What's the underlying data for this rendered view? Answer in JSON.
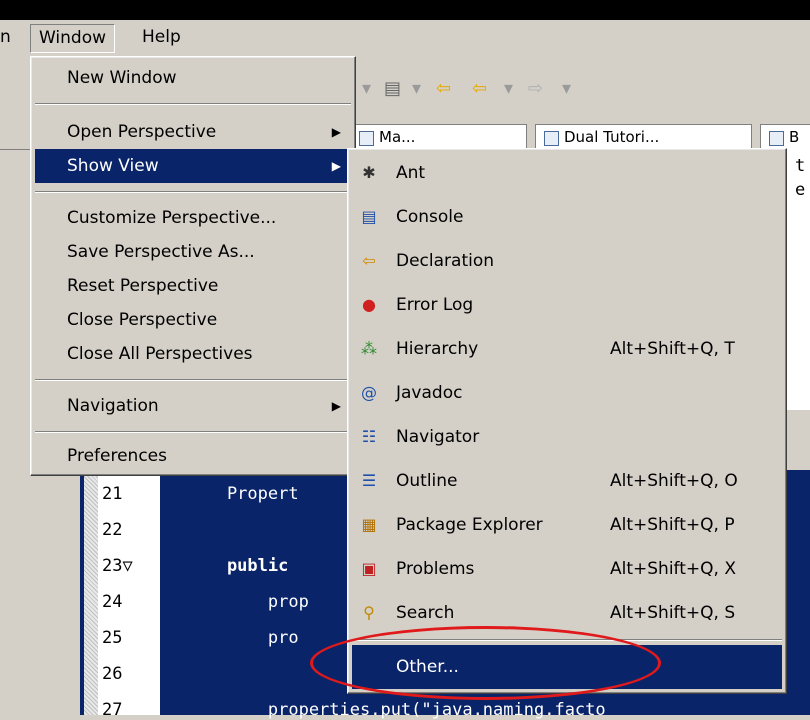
{
  "menubar": {
    "prev_label": "n",
    "window_label": "Window",
    "help_label": "Help"
  },
  "view_tabs": [
    {
      "label": "Ma..."
    },
    {
      "label": "Dual Tutori..."
    },
    {
      "label": "B"
    }
  ],
  "window_menu": {
    "items": [
      {
        "label": "New Window"
      },
      {
        "label": "Open Perspective",
        "submenu": true
      },
      {
        "label": "Show View",
        "submenu": true,
        "selected": true
      },
      {
        "label": "Customize Perspective..."
      },
      {
        "label": "Save Perspective As..."
      },
      {
        "label": "Reset Perspective"
      },
      {
        "label": "Close Perspective"
      },
      {
        "label": "Close All Perspectives"
      },
      {
        "label": "Navigation",
        "submenu": true
      },
      {
        "label": "Preferences"
      }
    ]
  },
  "show_view_menu": {
    "items": [
      {
        "label": "Ant",
        "icon": "ant-icon",
        "shortcut": ""
      },
      {
        "label": "Console",
        "icon": "console-icon",
        "shortcut": ""
      },
      {
        "label": "Declaration",
        "icon": "declaration-icon",
        "shortcut": ""
      },
      {
        "label": "Error Log",
        "icon": "error-log-icon",
        "shortcut": ""
      },
      {
        "label": "Hierarchy",
        "icon": "hierarchy-icon",
        "shortcut": "Alt+Shift+Q, T"
      },
      {
        "label": "Javadoc",
        "icon": "javadoc-icon",
        "shortcut": ""
      },
      {
        "label": "Navigator",
        "icon": "navigator-icon",
        "shortcut": ""
      },
      {
        "label": "Outline",
        "icon": "outline-icon",
        "shortcut": "Alt+Shift+Q, O"
      },
      {
        "label": "Package Explorer",
        "icon": "package-explorer-icon",
        "shortcut": "Alt+Shift+Q, P"
      },
      {
        "label": "Problems",
        "icon": "problems-icon",
        "shortcut": "Alt+Shift+Q, X"
      },
      {
        "label": "Search",
        "icon": "search-icon",
        "shortcut": "Alt+Shift+Q, S"
      },
      {
        "label": "Other...",
        "icon": "",
        "shortcut": "",
        "selected": true
      }
    ]
  },
  "editor": {
    "line_numbers": [
      "21",
      "22",
      "23▽",
      "24",
      "25",
      "26",
      "27"
    ],
    "code_lines": [
      {
        "text": "    Propert"
      },
      {
        "text": ""
      },
      {
        "text": "    public ",
        "bold": true
      },
      {
        "text": "        prop"
      },
      {
        "text": "        pro"
      },
      {
        "text": "             "
      },
      {
        "text": "        properties.put(\"java.naming.facto"
      }
    ],
    "partial_right": [
      {
        "text": "t"
      },
      {
        "text": "e"
      }
    ]
  },
  "colors": {
    "menu_bg": "#d4d0c8",
    "selection": "#0a246a",
    "highlight_ring": "#e0191b"
  }
}
